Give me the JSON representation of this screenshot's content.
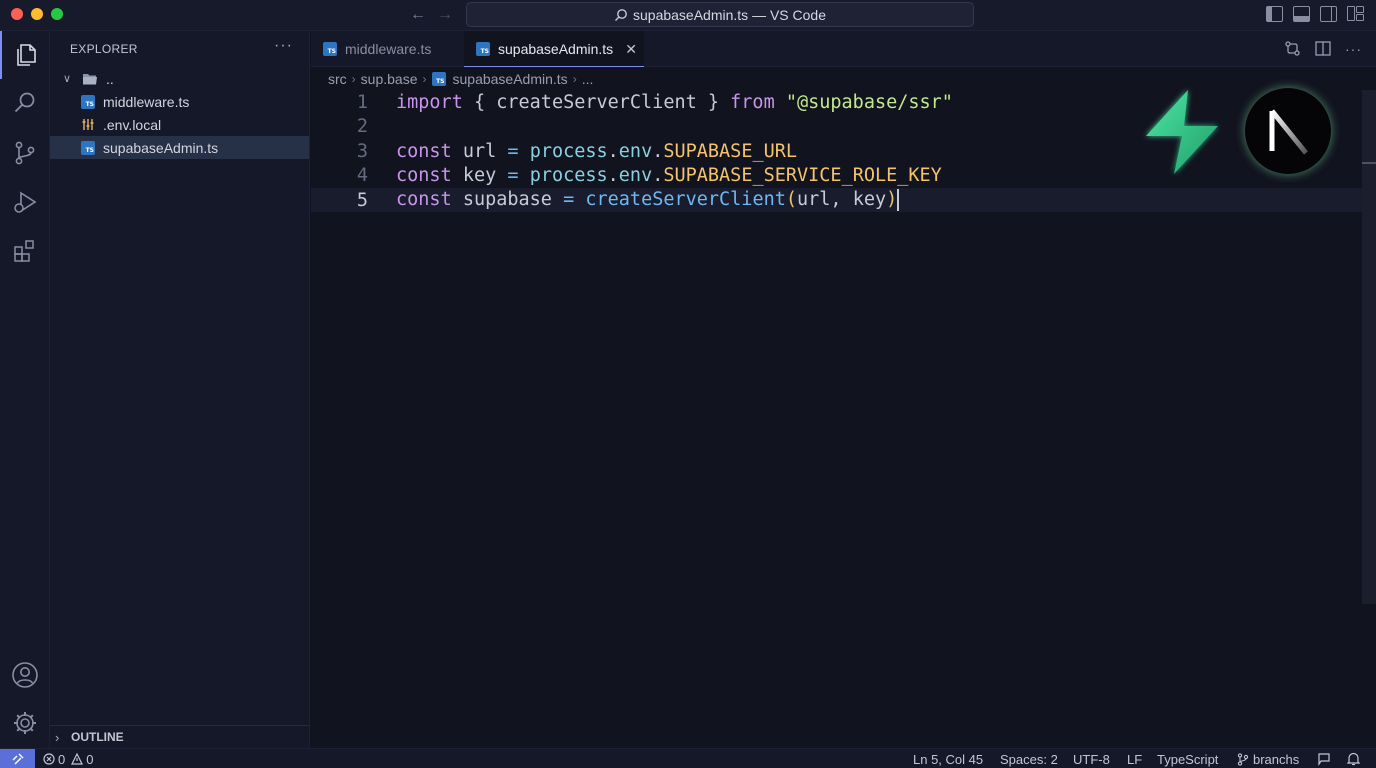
{
  "window": {
    "title": "supabaseAdmin.ts — VS Code"
  },
  "sidebar": {
    "title": "EXPLORER",
    "more": "···",
    "tree": [
      {
        "label": "..",
        "type": "folder"
      },
      {
        "label": "middleware.ts",
        "type": "ts"
      },
      {
        "label": ".env.local",
        "type": "env"
      },
      {
        "label": "supabaseAdmin.ts",
        "type": "ts",
        "selected": true
      }
    ],
    "outline": "OUTLINE"
  },
  "tabs": [
    {
      "label": "middleware.ts",
      "active": false
    },
    {
      "label": "supabaseAdmin.ts",
      "active": true
    }
  ],
  "breadcrumb": [
    "src",
    "sup.base",
    "supabaseAdmin.ts",
    "..."
  ],
  "code": {
    "line_numbers": [
      "1",
      "2",
      "3",
      "4",
      "5"
    ],
    "l1": {
      "import": "import",
      "open": "{",
      "name": "createServerClient",
      "close": "}",
      "from": "from",
      "module": "\"@supabase/ssr\""
    },
    "l3": {
      "kw": "const",
      "name": "url",
      "eq": "=",
      "process": "process",
      "env": "env",
      "var": "SUPABASE_URL"
    },
    "l4": {
      "kw": "const",
      "name": "key",
      "eq": "=",
      "process": "process",
      "env": "env",
      "var": "SUPABASE_SERVICE_ROLE_KEY"
    },
    "l5": {
      "kw": "const",
      "name": "supabase",
      "eq": "=",
      "fn": "createServerClient",
      "open": "(",
      "args": "url, key",
      "close": ")"
    }
  },
  "statusbar": {
    "errors": "0",
    "warnings": "0",
    "position": "Ln 5, Col 45",
    "spaces": "Spaces: 2",
    "encoding": "UTF-8",
    "eol": "LF",
    "language": "TypeScript",
    "branch": "branchs"
  },
  "colors": {
    "accent": "#7e8ff2",
    "keyword": "#c895ea",
    "function": "#6fb8f2",
    "string": "#c3e88d",
    "constant": "#f5c36b",
    "supabase_green": "#3ecf8e"
  }
}
